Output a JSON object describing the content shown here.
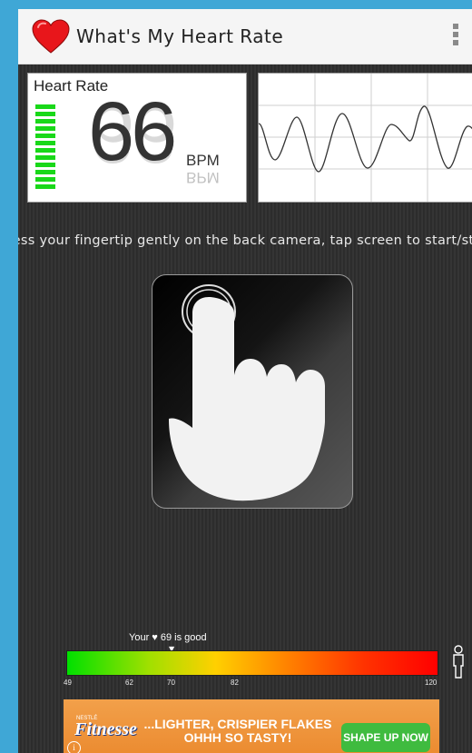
{
  "app": {
    "title": "What's My Heart Rate"
  },
  "heart_rate": {
    "label": "Heart Rate",
    "value": "66",
    "unit": "BPM"
  },
  "instruction": {
    "text": "Press your fingertip gently on the back camera, tap screen to start/stop"
  },
  "scale": {
    "caption": "Your ♥ 69 is good",
    "ticks": [
      "49",
      "62",
      "70",
      "82",
      "120"
    ],
    "current_value": 69,
    "min": 49,
    "max": 120
  },
  "ad": {
    "brand": "Fitnesse",
    "brand_tag": "NESTLÉ",
    "headline": "...LIGHTER, CRISPIER FLAKES OHHH SO TASTY!",
    "cta": "SHAPE UP NOW",
    "info": "i"
  },
  "colors": {
    "status_bar": "#3fa7d6",
    "heart": "#e8161b",
    "level_bars": "#19d819",
    "cta": "#3fbb3f"
  },
  "icons": {
    "logo": "heart-icon",
    "menu": "overflow-menu-icon",
    "finger": "fingertip-icon",
    "person": "person-icon"
  }
}
